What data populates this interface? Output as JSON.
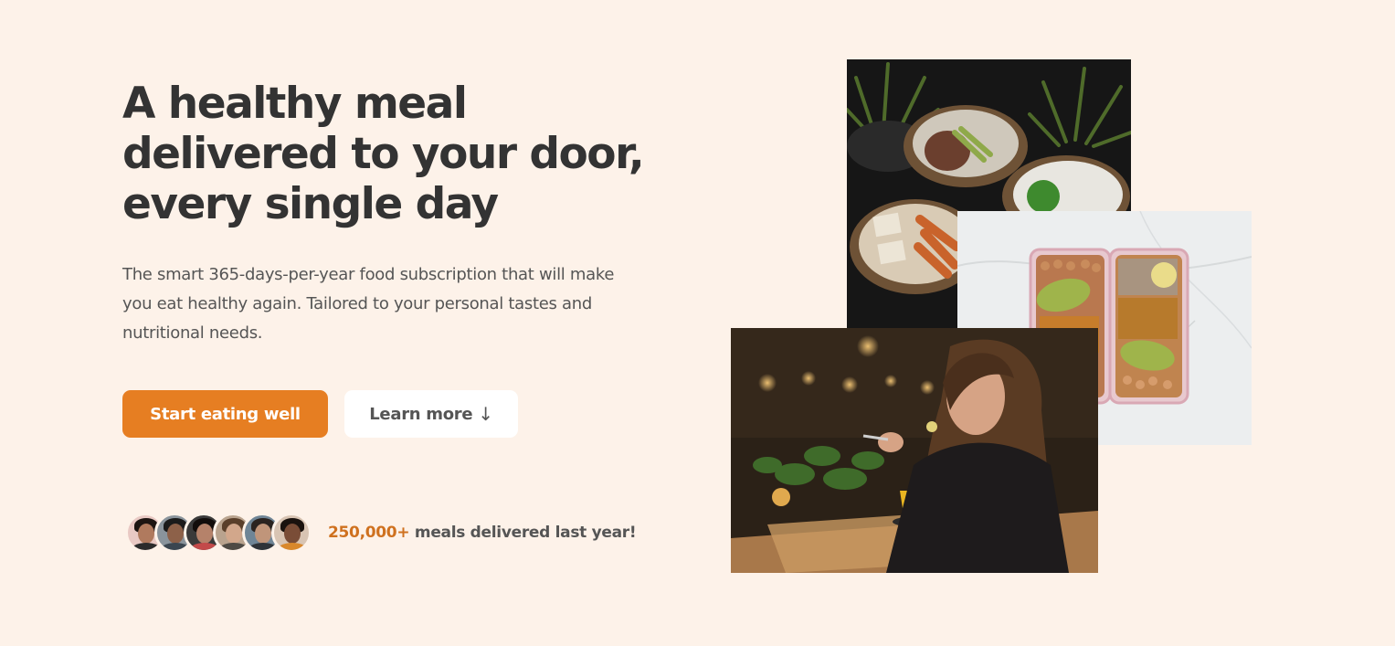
{
  "hero": {
    "title": "A healthy meal delivered to your door, every single day",
    "description": "The smart 365-days-per-year food subscription that will make you eat healthy again. Tailored to your personal tastes and nutritional needs."
  },
  "buttons": {
    "primary_label": "Start eating well",
    "secondary_label": "Learn more",
    "secondary_icon": "↓"
  },
  "delivered": {
    "count": "250,000+",
    "text": "meals delivered last year!"
  },
  "colors": {
    "background": "#fdf2e9",
    "accent": "#e67e22",
    "text": "#333333"
  }
}
